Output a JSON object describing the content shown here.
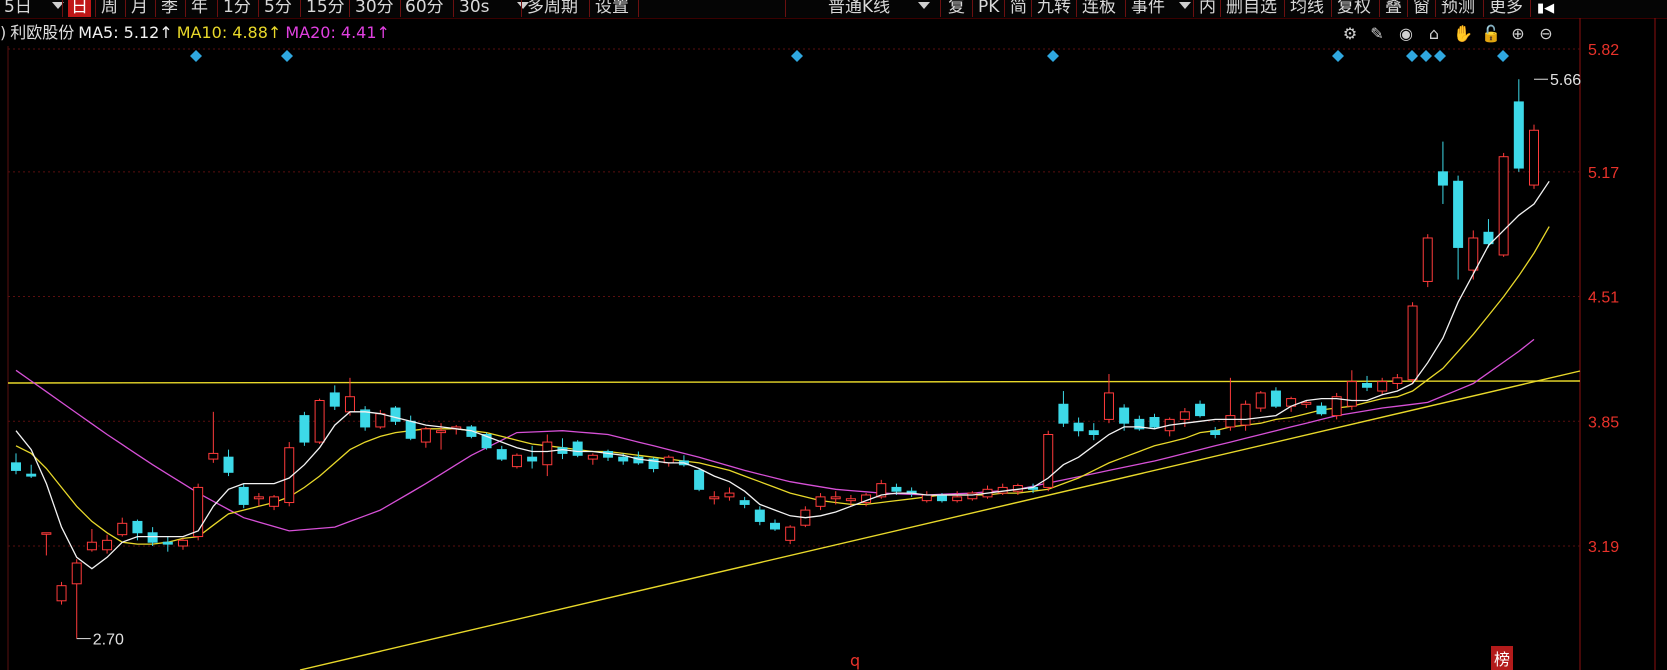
{
  "toolbar": {
    "left_buttons": [
      {
        "label": "5日",
        "x": 4,
        "dropdown": true
      },
      {
        "label": "日",
        "x": 68,
        "active": true
      },
      {
        "label": "周",
        "x": 101
      },
      {
        "label": "月",
        "x": 131
      },
      {
        "label": "季",
        "x": 161
      },
      {
        "label": "年",
        "x": 191
      },
      {
        "label": "1分",
        "x": 223
      },
      {
        "label": "5分",
        "x": 264
      },
      {
        "label": "15分",
        "x": 306
      },
      {
        "label": "30分",
        "x": 355
      },
      {
        "label": "60分",
        "x": 405
      },
      {
        "label": "30s",
        "x": 459,
        "dropdown": true
      },
      {
        "label": "多周期",
        "x": 527
      },
      {
        "label": "设置",
        "x": 595
      }
    ],
    "right_buttons": [
      {
        "label": "普通K线",
        "x": 828,
        "dropdown": true
      },
      {
        "label": "复",
        "x": 948
      },
      {
        "label": "PK",
        "x": 978
      },
      {
        "label": "简",
        "x": 1010
      },
      {
        "label": "九转",
        "x": 1037
      },
      {
        "label": "连板",
        "x": 1082
      },
      {
        "label": "事件",
        "x": 1131,
        "dropdown": true
      },
      {
        "label": "内",
        "x": 1199
      },
      {
        "label": "删自选",
        "x": 1226
      },
      {
        "label": "均线",
        "x": 1290
      },
      {
        "label": "复权",
        "x": 1337
      },
      {
        "label": "叠",
        "x": 1385
      },
      {
        "label": "窗",
        "x": 1413
      },
      {
        "label": "预测",
        "x": 1441
      },
      {
        "label": "更多",
        "x": 1489
      }
    ]
  },
  "legend": {
    "prefix": ")",
    "name": "利欧股份",
    "ma5_label": "MA5: 5.12↑",
    "ma10_label": "MA10: 4.88↑",
    "ma20_label": "MA20: 4.41↑"
  },
  "colors": {
    "up": "#ff3b3b",
    "down": "#3dd9e8",
    "ma5": "#f2f2f2",
    "ma10": "#e8d82a",
    "ma20": "#d650d6",
    "trendline": "#e8d82a",
    "grid": "#5a0f0f",
    "axis_label": "#e8322a",
    "marker": "#2fa8e0"
  },
  "tool_icons": [
    "gear-icon",
    "pen-icon",
    "eye-icon",
    "toolbox-icon",
    "hand-icon",
    "lock-icon",
    "zoom-in-icon",
    "zoom-out-icon"
  ],
  "bottom_tags": {
    "event_marker": "q",
    "list_badge": "榜"
  },
  "chart_data": {
    "type": "candlestick",
    "y_axis_ticks": [
      "5.82",
      "5.17",
      "4.51",
      "3.85",
      "3.19"
    ],
    "ylim": [
      2.57,
      5.85
    ],
    "grid": true,
    "annotations": {
      "high_label": "5.66",
      "low_label": "2.70"
    },
    "candles": [
      {
        "o": 3.63,
        "h": 3.68,
        "l": 3.57,
        "c": 3.59
      },
      {
        "o": 3.57,
        "h": 3.62,
        "l": 3.55,
        "c": 3.56
      },
      {
        "o": 3.26,
        "h": 3.26,
        "l": 3.14,
        "c": 3.26
      },
      {
        "o": 2.9,
        "h": 3.0,
        "l": 2.88,
        "c": 2.98
      },
      {
        "o": 2.99,
        "h": 3.12,
        "l": 2.7,
        "c": 3.1
      },
      {
        "o": 3.17,
        "h": 3.28,
        "l": 3.16,
        "c": 3.21
      },
      {
        "o": 3.17,
        "h": 3.25,
        "l": 3.15,
        "c": 3.22
      },
      {
        "o": 3.25,
        "h": 3.34,
        "l": 3.24,
        "c": 3.31
      },
      {
        "o": 3.32,
        "h": 3.33,
        "l": 3.22,
        "c": 3.26
      },
      {
        "o": 3.26,
        "h": 3.29,
        "l": 3.19,
        "c": 3.21
      },
      {
        "o": 3.21,
        "h": 3.24,
        "l": 3.16,
        "c": 3.2
      },
      {
        "o": 3.19,
        "h": 3.23,
        "l": 3.17,
        "c": 3.22
      },
      {
        "o": 3.24,
        "h": 3.52,
        "l": 3.22,
        "c": 3.5
      },
      {
        "o": 3.65,
        "h": 3.9,
        "l": 3.63,
        "c": 3.68
      },
      {
        "o": 3.66,
        "h": 3.7,
        "l": 3.56,
        "c": 3.58
      },
      {
        "o": 3.5,
        "h": 3.52,
        "l": 3.39,
        "c": 3.41
      },
      {
        "o": 3.44,
        "h": 3.47,
        "l": 3.4,
        "c": 3.45
      },
      {
        "o": 3.4,
        "h": 3.46,
        "l": 3.38,
        "c": 3.45
      },
      {
        "o": 3.42,
        "h": 3.74,
        "l": 3.4,
        "c": 3.71
      },
      {
        "o": 3.88,
        "h": 3.9,
        "l": 3.72,
        "c": 3.74
      },
      {
        "o": 3.74,
        "h": 3.97,
        "l": 3.73,
        "c": 3.96
      },
      {
        "o": 4.0,
        "h": 4.04,
        "l": 3.91,
        "c": 3.93
      },
      {
        "o": 3.9,
        "h": 4.08,
        "l": 3.88,
        "c": 3.98
      },
      {
        "o": 3.91,
        "h": 3.93,
        "l": 3.8,
        "c": 3.82
      },
      {
        "o": 3.82,
        "h": 3.91,
        "l": 3.81,
        "c": 3.89
      },
      {
        "o": 3.92,
        "h": 3.93,
        "l": 3.83,
        "c": 3.85
      },
      {
        "o": 3.85,
        "h": 3.88,
        "l": 3.75,
        "c": 3.76
      },
      {
        "o": 3.74,
        "h": 3.82,
        "l": 3.71,
        "c": 3.81
      },
      {
        "o": 3.79,
        "h": 3.84,
        "l": 3.7,
        "c": 3.8
      },
      {
        "o": 3.81,
        "h": 3.83,
        "l": 3.78,
        "c": 3.82
      },
      {
        "o": 3.82,
        "h": 3.83,
        "l": 3.76,
        "c": 3.77
      },
      {
        "o": 3.78,
        "h": 3.79,
        "l": 3.7,
        "c": 3.71
      },
      {
        "o": 3.7,
        "h": 3.72,
        "l": 3.64,
        "c": 3.65
      },
      {
        "o": 3.61,
        "h": 3.68,
        "l": 3.6,
        "c": 3.67
      },
      {
        "o": 3.66,
        "h": 3.72,
        "l": 3.6,
        "c": 3.64
      },
      {
        "o": 3.62,
        "h": 3.78,
        "l": 3.56,
        "c": 3.74
      },
      {
        "o": 3.71,
        "h": 3.76,
        "l": 3.65,
        "c": 3.68
      },
      {
        "o": 3.74,
        "h": 3.75,
        "l": 3.66,
        "c": 3.67
      },
      {
        "o": 3.65,
        "h": 3.68,
        "l": 3.62,
        "c": 3.67
      },
      {
        "o": 3.69,
        "h": 3.7,
        "l": 3.64,
        "c": 3.66
      },
      {
        "o": 3.66,
        "h": 3.68,
        "l": 3.62,
        "c": 3.64
      },
      {
        "o": 3.66,
        "h": 3.69,
        "l": 3.62,
        "c": 3.63
      },
      {
        "o": 3.65,
        "h": 3.66,
        "l": 3.58,
        "c": 3.6
      },
      {
        "o": 3.63,
        "h": 3.67,
        "l": 3.61,
        "c": 3.66
      },
      {
        "o": 3.64,
        "h": 3.67,
        "l": 3.61,
        "c": 3.62
      },
      {
        "o": 3.59,
        "h": 3.6,
        "l": 3.48,
        "c": 3.49
      },
      {
        "o": 3.44,
        "h": 3.48,
        "l": 3.41,
        "c": 3.45
      },
      {
        "o": 3.45,
        "h": 3.5,
        "l": 3.43,
        "c": 3.47
      },
      {
        "o": 3.43,
        "h": 3.45,
        "l": 3.39,
        "c": 3.41
      },
      {
        "o": 3.38,
        "h": 3.4,
        "l": 3.3,
        "c": 3.32
      },
      {
        "o": 3.31,
        "h": 3.33,
        "l": 3.27,
        "c": 3.28
      },
      {
        "o": 3.22,
        "h": 3.3,
        "l": 3.2,
        "c": 3.29
      },
      {
        "o": 3.3,
        "h": 3.4,
        "l": 3.29,
        "c": 3.38
      },
      {
        "o": 3.4,
        "h": 3.47,
        "l": 3.38,
        "c": 3.45
      },
      {
        "o": 3.44,
        "h": 3.48,
        "l": 3.41,
        "c": 3.45
      },
      {
        "o": 3.43,
        "h": 3.46,
        "l": 3.4,
        "c": 3.44
      },
      {
        "o": 3.42,
        "h": 3.47,
        "l": 3.4,
        "c": 3.46
      },
      {
        "o": 3.45,
        "h": 3.54,
        "l": 3.44,
        "c": 3.52
      },
      {
        "o": 3.5,
        "h": 3.52,
        "l": 3.46,
        "c": 3.48
      },
      {
        "o": 3.48,
        "h": 3.5,
        "l": 3.45,
        "c": 3.47
      },
      {
        "o": 3.43,
        "h": 3.48,
        "l": 3.42,
        "c": 3.46
      },
      {
        "o": 3.46,
        "h": 3.47,
        "l": 3.42,
        "c": 3.43
      },
      {
        "o": 3.43,
        "h": 3.48,
        "l": 3.42,
        "c": 3.45
      },
      {
        "o": 3.44,
        "h": 3.48,
        "l": 3.43,
        "c": 3.47
      },
      {
        "o": 3.45,
        "h": 3.51,
        "l": 3.44,
        "c": 3.49
      },
      {
        "o": 3.47,
        "h": 3.52,
        "l": 3.46,
        "c": 3.5
      },
      {
        "o": 3.48,
        "h": 3.52,
        "l": 3.46,
        "c": 3.51
      },
      {
        "o": 3.5,
        "h": 3.52,
        "l": 3.47,
        "c": 3.49
      },
      {
        "o": 3.5,
        "h": 3.8,
        "l": 3.48,
        "c": 3.78
      },
      {
        "o": 3.94,
        "h": 4.01,
        "l": 3.82,
        "c": 3.84
      },
      {
        "o": 3.84,
        "h": 3.87,
        "l": 3.77,
        "c": 3.8
      },
      {
        "o": 3.8,
        "h": 3.84,
        "l": 3.75,
        "c": 3.78
      },
      {
        "o": 3.86,
        "h": 4.1,
        "l": 3.84,
        "c": 4.0
      },
      {
        "o": 3.92,
        "h": 3.94,
        "l": 3.8,
        "c": 3.84
      },
      {
        "o": 3.86,
        "h": 3.88,
        "l": 3.8,
        "c": 3.81
      },
      {
        "o": 3.87,
        "h": 3.89,
        "l": 3.81,
        "c": 3.82
      },
      {
        "o": 3.8,
        "h": 3.87,
        "l": 3.77,
        "c": 3.86
      },
      {
        "o": 3.86,
        "h": 3.92,
        "l": 3.82,
        "c": 3.9
      },
      {
        "o": 3.94,
        "h": 3.96,
        "l": 3.87,
        "c": 3.88
      },
      {
        "o": 3.8,
        "h": 3.82,
        "l": 3.76,
        "c": 3.78
      },
      {
        "o": 3.82,
        "h": 4.08,
        "l": 3.8,
        "c": 3.88
      },
      {
        "o": 3.83,
        "h": 3.96,
        "l": 3.8,
        "c": 3.94
      },
      {
        "o": 3.92,
        "h": 4.01,
        "l": 3.9,
        "c": 4.0
      },
      {
        "o": 4.01,
        "h": 4.03,
        "l": 3.92,
        "c": 3.93
      },
      {
        "o": 3.93,
        "h": 3.98,
        "l": 3.9,
        "c": 3.97
      },
      {
        "o": 3.94,
        "h": 3.96,
        "l": 3.92,
        "c": 3.95
      },
      {
        "o": 3.93,
        "h": 3.95,
        "l": 3.88,
        "c": 3.89
      },
      {
        "o": 3.88,
        "h": 4.0,
        "l": 3.86,
        "c": 3.98
      },
      {
        "o": 3.93,
        "h": 4.12,
        "l": 3.91,
        "c": 4.06
      },
      {
        "o": 4.05,
        "h": 4.09,
        "l": 4.01,
        "c": 4.03
      },
      {
        "o": 4.01,
        "h": 4.08,
        "l": 3.99,
        "c": 4.06
      },
      {
        "o": 4.05,
        "h": 4.1,
        "l": 4.02,
        "c": 4.08
      },
      {
        "o": 4.07,
        "h": 4.48,
        "l": 4.05,
        "c": 4.46
      },
      {
        "o": 4.59,
        "h": 4.84,
        "l": 4.56,
        "c": 4.82
      },
      {
        "o": 5.17,
        "h": 5.33,
        "l": 5.0,
        "c": 5.1
      },
      {
        "o": 5.12,
        "h": 5.15,
        "l": 4.6,
        "c": 4.77
      },
      {
        "o": 4.65,
        "h": 4.86,
        "l": 4.6,
        "c": 4.82
      },
      {
        "o": 4.85,
        "h": 4.92,
        "l": 4.77,
        "c": 4.79
      },
      {
        "o": 4.73,
        "h": 5.27,
        "l": 4.72,
        "c": 5.25
      },
      {
        "o": 5.54,
        "h": 5.66,
        "l": 5.17,
        "c": 5.19
      },
      {
        "o": 5.1,
        "h": 5.42,
        "l": 5.08,
        "c": 5.39
      }
    ],
    "ma5": [
      3.8,
      3.7,
      3.52,
      3.29,
      3.13,
      3.07,
      3.13,
      3.21,
      3.24,
      3.24,
      3.24,
      3.24,
      3.27,
      3.4,
      3.49,
      3.52,
      3.52,
      3.52,
      3.55,
      3.62,
      3.71,
      3.83,
      3.9,
      3.9,
      3.89,
      3.87,
      3.85,
      3.83,
      3.82,
      3.81,
      3.8,
      3.77,
      3.74,
      3.71,
      3.69,
      3.69,
      3.7,
      3.69,
      3.69,
      3.68,
      3.67,
      3.65,
      3.64,
      3.63,
      3.63,
      3.6,
      3.56,
      3.53,
      3.48,
      3.41,
      3.38,
      3.35,
      3.34,
      3.35,
      3.37,
      3.4,
      3.43,
      3.46,
      3.47,
      3.47,
      3.46,
      3.46,
      3.46,
      3.46,
      3.47,
      3.48,
      3.49,
      3.5,
      3.55,
      3.62,
      3.66,
      3.72,
      3.78,
      3.82,
      3.82,
      3.81,
      3.83,
      3.84,
      3.85,
      3.86,
      3.86,
      3.86,
      3.87,
      3.88,
      3.93,
      3.96,
      3.97,
      3.97,
      3.96,
      3.96,
      3.99,
      4.01,
      4.05,
      4.16,
      4.29,
      4.48,
      4.63,
      4.78,
      4.86,
      4.94,
      5.0,
      5.12
    ],
    "ma10": [
      3.72,
      3.68,
      3.6,
      3.5,
      3.4,
      3.32,
      3.26,
      3.21,
      3.2,
      3.2,
      3.21,
      3.23,
      3.24,
      3.3,
      3.36,
      3.38,
      3.4,
      3.42,
      3.45,
      3.5,
      3.56,
      3.63,
      3.7,
      3.74,
      3.77,
      3.79,
      3.8,
      3.81,
      3.81,
      3.81,
      3.8,
      3.79,
      3.77,
      3.75,
      3.73,
      3.72,
      3.71,
      3.7,
      3.69,
      3.69,
      3.68,
      3.67,
      3.66,
      3.65,
      3.64,
      3.63,
      3.61,
      3.59,
      3.56,
      3.53,
      3.5,
      3.47,
      3.45,
      3.43,
      3.42,
      3.41,
      3.41,
      3.42,
      3.43,
      3.44,
      3.45,
      3.46,
      3.46,
      3.46,
      3.46,
      3.47,
      3.47,
      3.48,
      3.49,
      3.52,
      3.55,
      3.59,
      3.63,
      3.66,
      3.69,
      3.72,
      3.74,
      3.76,
      3.79,
      3.8,
      3.82,
      3.83,
      3.84,
      3.86,
      3.87,
      3.89,
      3.91,
      3.92,
      3.93,
      3.95,
      3.97,
      3.98,
      4.01,
      4.07,
      4.13,
      4.22,
      4.31,
      4.41,
      4.51,
      4.62,
      4.74,
      4.88
    ]
  }
}
